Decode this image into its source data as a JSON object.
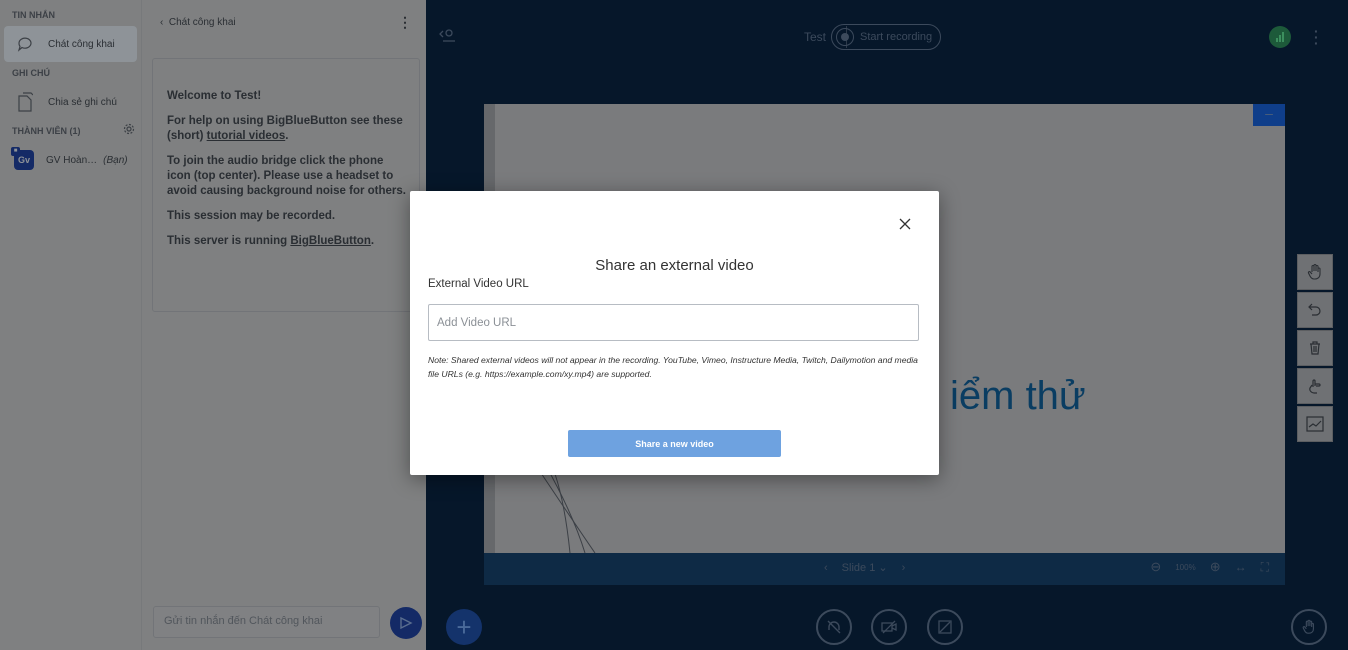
{
  "sidebar": {
    "messages_heading": "TIN NHẮN",
    "public_chat_label": "Chát công khai",
    "notes_heading": "GHI CHÚ",
    "shared_notes_label": "Chia sẻ ghi chú",
    "users_heading": "THÀNH VIÊN (1)",
    "user": {
      "initials": "Gv",
      "name": "GV Hoàn…",
      "you_tag": "(Bạn)"
    }
  },
  "chat": {
    "title": "Chát công khai",
    "welcome": "Welcome to Test!",
    "help_text": "For help on using BigBlueButton see these (short)",
    "help_link": "tutorial videos",
    "audio_text": "To join the audio bridge click the phone icon (top center). Please use a headset to avoid causing background noise for others.",
    "recorded_text": "This session may be recorded.",
    "server_text": "This server is running",
    "server_link": "BigBlueButton",
    "input_placeholder": "Gửi tin nhắn đến Chát công khai"
  },
  "topbar": {
    "meeting_title": "Test",
    "record_label": "Start recording"
  },
  "presentation": {
    "slide_text": "iểm thử",
    "slide_label": "Slide 1",
    "zoom": "100%"
  },
  "modal": {
    "title": "Share an external video",
    "url_label": "External Video URL",
    "url_placeholder": "Add Video URL",
    "note": "Note: Shared external videos will not appear in the recording. YouTube, Vimeo, Instructure Media, Twitch, Dailymotion and media file URLs (e.g. https://example.com/xy.mp4) are supported.",
    "share_button": "Share a new video"
  },
  "colors": {
    "accent": "#6ea2e0",
    "background": "#06172a",
    "slide_text": "#0a3d62"
  }
}
